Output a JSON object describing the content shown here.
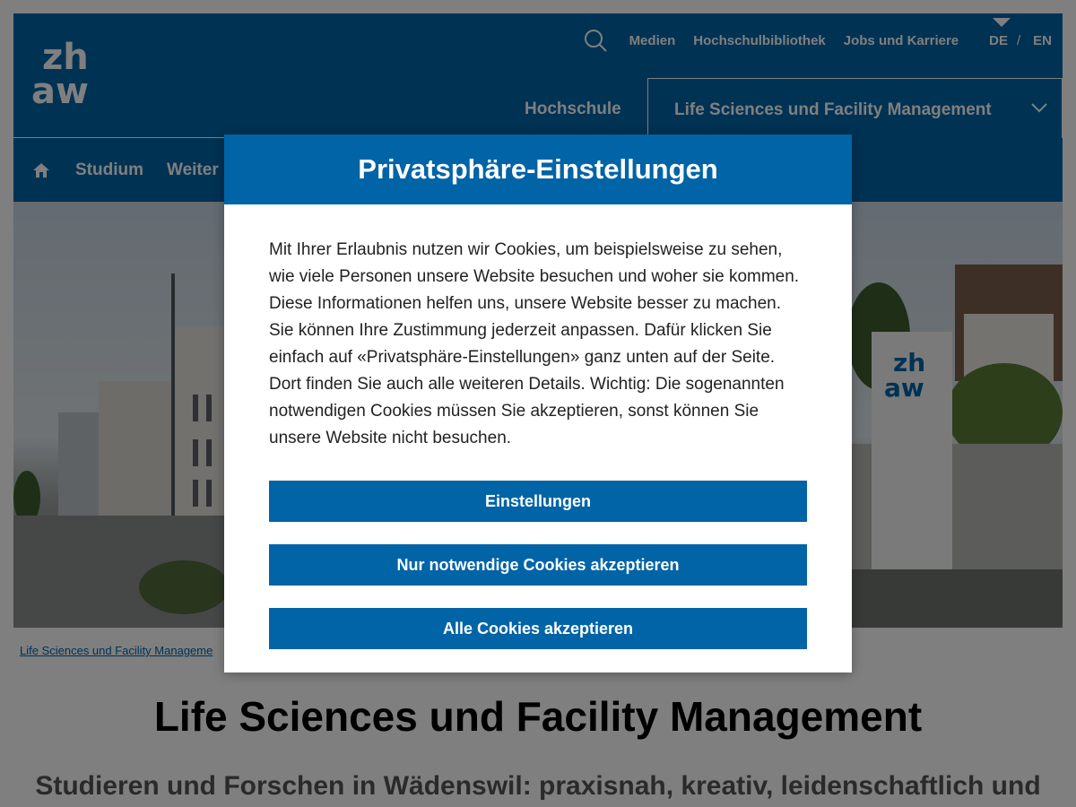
{
  "header": {
    "top_links": [
      "Medien",
      "Hochschulbibliothek",
      "Jobs und Karriere"
    ],
    "lang_de": "DE",
    "lang_sep": "/",
    "lang_en": "EN",
    "org_hochschule": "Hochschule",
    "org_department": "Life Sciences und Facility Management",
    "main_nav": [
      "Studium",
      "Weiter"
    ]
  },
  "breadcrumb": "Life Sciences und Facility Manageme",
  "page": {
    "title": "Life Sciences und Facility Management",
    "subtitle": "Studieren und Forschen in Wädenswil: praxisnah, kreativ, leidenschaftlich und"
  },
  "modal": {
    "title": "Privatsphäre-Einstellungen",
    "text": "Mit Ihrer Erlaubnis nutzen wir Cookies, um beispielsweise zu sehen, wie viele Personen unsere Website besuchen und woher sie kommen. Diese Informationen helfen uns, unsere Website besser zu machen. Sie können Ihre Zustimmung jederzeit anpassen. Dafür klicken Sie einfach auf «Privatsphäre-Einstellungen» ganz unten auf der Seite. Dort finden Sie auch alle weiteren Details. Wichtig: Die sogenannten notwendigen Cookies müssen Sie akzeptieren, sonst können Sie unsere Website nicht besuchen.",
    "btn_settings": "Einstellungen",
    "btn_necessary": "Nur notwendige Cookies akzeptieren",
    "btn_all": "Alle Cookies akzeptieren"
  },
  "colors": {
    "brand": "#0064a6",
    "overlay": "rgba(0,0,0,0.5)"
  },
  "icons": [
    "zhaw-logo",
    "search-icon",
    "chevron-down-icon",
    "home-icon"
  ]
}
